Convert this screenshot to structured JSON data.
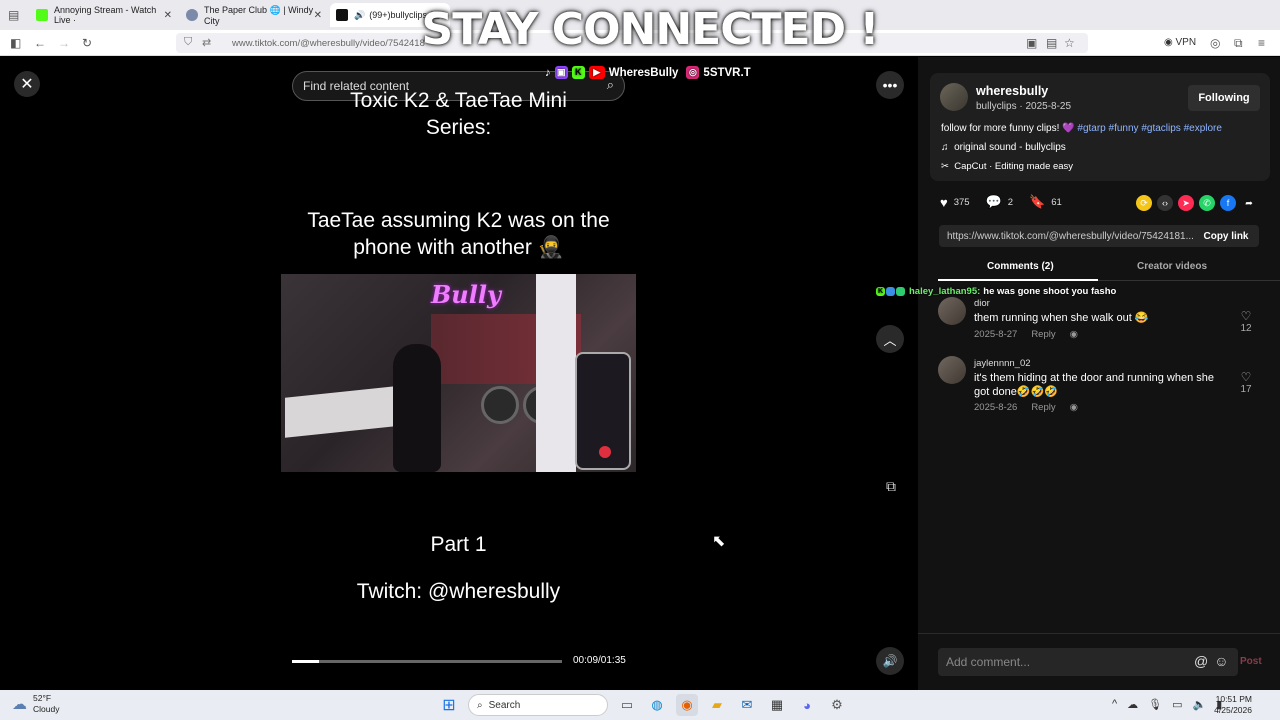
{
  "overlay_title": "STAY CONNECTED !",
  "browser": {
    "tabs": [
      {
        "label": "Annoying Stream - Watch Live ·",
        "color": "#53fc18"
      },
      {
        "label": "The Paper Club 🌐 | Windy City",
        "color": "#7a8aa8"
      },
      {
        "label": "(99+)bullyclips (@",
        "color": "#111111"
      }
    ],
    "url": "www.tiktok.com/@wheresbully/video/7542418",
    "vpn_label": "VPN"
  },
  "video": {
    "search_placeholder": "Find related content",
    "title_line": "Toxic K2 & TaeTae Mini Series:",
    "caption_line": "TaeTae assuming K2 was on the phone with another 🥷",
    "part": "Part 1",
    "twitch": "Twitch: @wheresbully",
    "logo_text": "Bully",
    "progress_fraction": 0.1,
    "time": "00:09/01:35",
    "social_handle_1": "WheresBully",
    "social_handle_2": "5STVR.T"
  },
  "post": {
    "author": "wheresbully",
    "sub": "bullyclips · 2025-8-25",
    "following_label": "Following",
    "desc_text": "follow for more funny clips! 💜",
    "desc_tags": "#gtarp #funny #gtaclips #explore",
    "music": "original sound - bullyclips",
    "capcut": "CapCut · Editing made easy",
    "likes": "375",
    "comments": "2",
    "saves": "61",
    "link": "https://www.tiktok.com/@wheresbully/video/75424181...",
    "copy_label": "Copy link"
  },
  "panel_tabs": {
    "comments": "Comments (2)",
    "creator": "Creator videos"
  },
  "chat": {
    "user": "haley_lathan95:",
    "message": "he was gone shoot you fasho"
  },
  "comments": [
    {
      "user": "dior",
      "text": "them running when she walk out 😂",
      "date": "2025-8-27",
      "reply": "Reply",
      "likes": "12"
    },
    {
      "user": "jaylennnn_02",
      "text": "it's them hiding at the door and running when she got done🤣🤣🤣",
      "date": "2025-8-26",
      "reply": "Reply",
      "likes": "17"
    }
  ],
  "comment_bar": {
    "placeholder": "Add comment...",
    "post_label": "Post"
  },
  "taskbar": {
    "temp": "52°F",
    "condition": "Cloudy",
    "search_label": "Search",
    "time": "10:51 PM",
    "date": "4/25/2026"
  }
}
